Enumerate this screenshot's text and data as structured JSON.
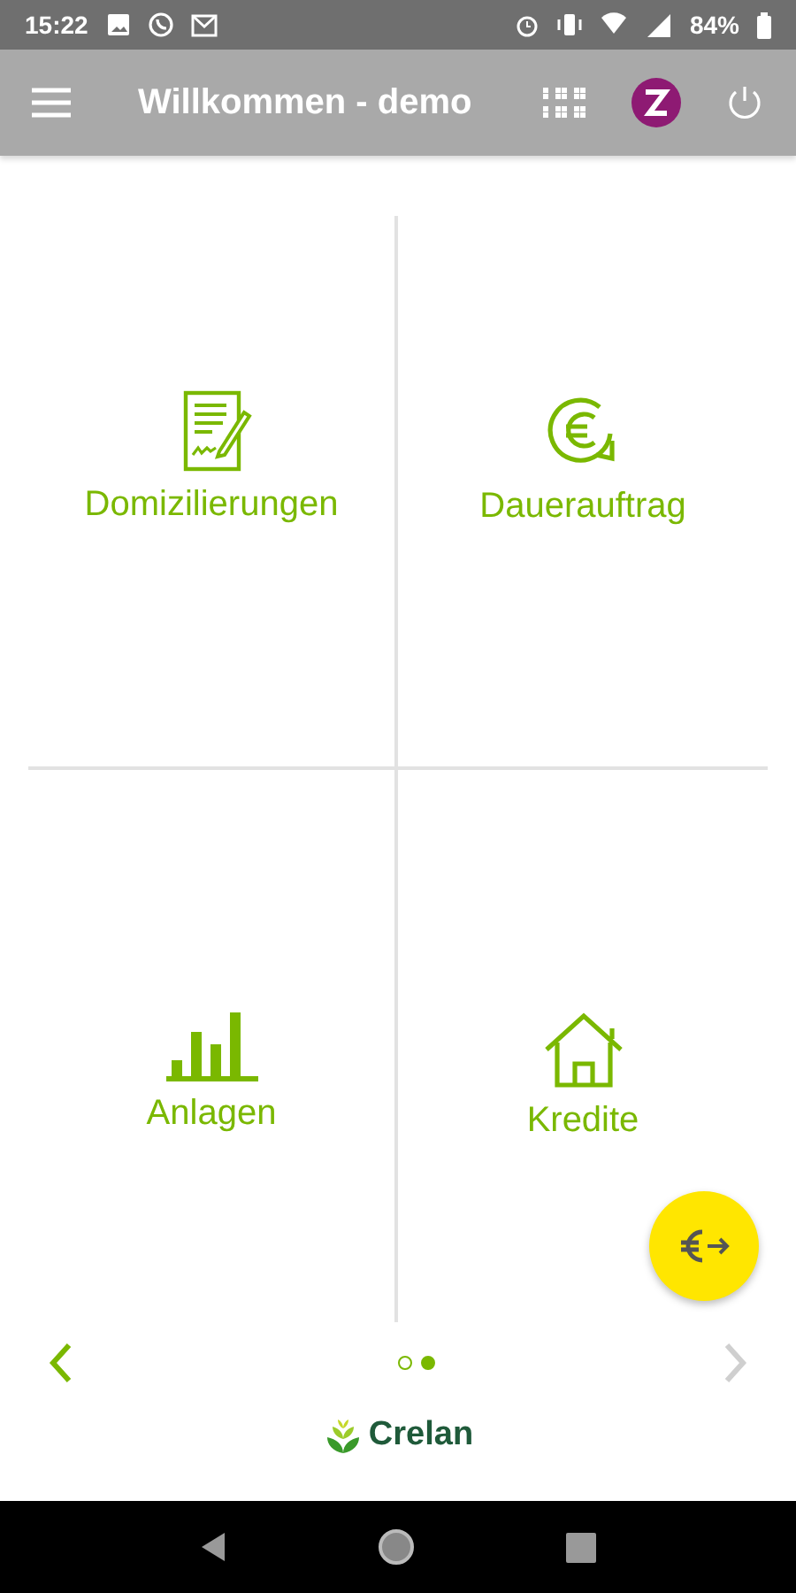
{
  "status_bar": {
    "time": "15:22",
    "battery": "84%"
  },
  "app_bar": {
    "title": "Willkommen - demo"
  },
  "tiles": [
    {
      "kind": "document",
      "label": "Domizilierungen"
    },
    {
      "kind": "recurring",
      "label": "Dauerauftrag"
    },
    {
      "kind": "chart",
      "label": "Anlagen"
    },
    {
      "kind": "house",
      "label": "Kredite"
    }
  ],
  "pager": {
    "prev_disabled": false,
    "next_disabled": true,
    "dots": [
      {
        "selected": false
      },
      {
        "selected": true
      }
    ]
  },
  "brand": {
    "name": "Crelan"
  }
}
